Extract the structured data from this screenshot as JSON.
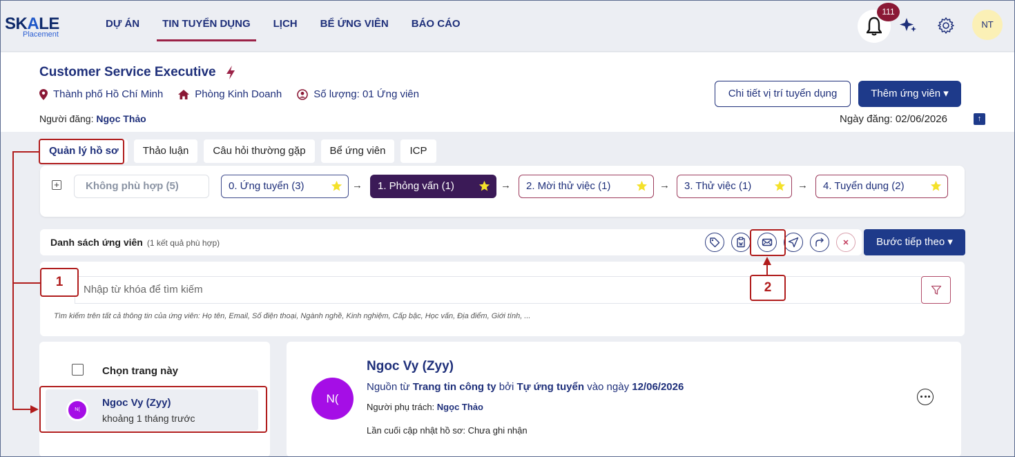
{
  "logo": {
    "main_prefix": "SK",
    "main_accent": "A",
    "main_suffix": "LE",
    "sub": "Placement"
  },
  "nav": {
    "items": [
      "DỰ ÁN",
      "TIN TUYỂN DỤNG",
      "LỊCH",
      "BỂ ỨNG VIÊN",
      "BÁO CÁO"
    ],
    "active": "TIN TUYỂN DỤNG"
  },
  "header": {
    "notification_count": "111",
    "user_initials": "NT"
  },
  "job": {
    "title": "Customer Service Executive",
    "location": "Thành phố Hồ Chí Minh",
    "department": "Phòng Kinh Doanh",
    "quantity": "Số lượng: 01 Ứng viên",
    "poster_label": "Người đăng:",
    "poster_name": "Ngọc Thảo",
    "detail_button": "Chi tiết vị trí tuyển dụng",
    "add_button": "Thêm ứng viên ▾",
    "post_date": "Ngày đăng: 02/06/2026"
  },
  "tabs": [
    "Quản lý hồ sơ",
    "Thảo luận",
    "Câu hỏi thường gặp",
    "Bể ứng viên",
    "ICP"
  ],
  "pipeline": {
    "rejected": "Không phù hợp (5)",
    "stages": [
      "0. Ứng tuyển (3)",
      "1. Phỏng vấn (1)",
      "2. Mời thử việc (1)",
      "3. Thử việc (1)",
      "4. Tuyển dụng (2)"
    ],
    "active_index": 1
  },
  "list": {
    "title": "Danh sách ứng viên",
    "count": "(1 kết quả phù hợp)",
    "next_step": "Bước tiếp theo ▾"
  },
  "search": {
    "placeholder": "Nhập từ khóa để tìm kiếm",
    "hint": "Tìm kiếm trên tất cả thông tin của ứng viên: Họ tên, Email, Số điện thoại, Ngành nghề, Kinh nghiệm, Cấp bậc, Học vấn, Địa điểm, Giới tính, ..."
  },
  "candidates": {
    "select_page": "Chọn trang này",
    "items": [
      {
        "name": "Ngoc Vy (Zyy)",
        "time": "khoảng 1 tháng trước",
        "initials": "N("
      }
    ]
  },
  "detail": {
    "initials": "N(",
    "name": "Ngoc Vy (Zyy)",
    "source_prefix": "Nguồn từ",
    "source_channel": "Trang tin công ty",
    "source_by": "bởi",
    "source_method": "Tự ứng tuyển",
    "source_on": "vào ngày",
    "source_date": "12/06/2026",
    "owner_label": "Người phụ trách:",
    "owner_name": "Ngọc Thảo",
    "updated": "Lần cuối cập nhật hồ sơ: Chưa ghi nhận"
  },
  "annotations": {
    "one": "1",
    "two": "2"
  },
  "colors": {
    "primary": "#1e3a8a",
    "active_stage": "#3b1a57",
    "annotation": "#b01c1c",
    "avatar": "#a50ee6"
  }
}
